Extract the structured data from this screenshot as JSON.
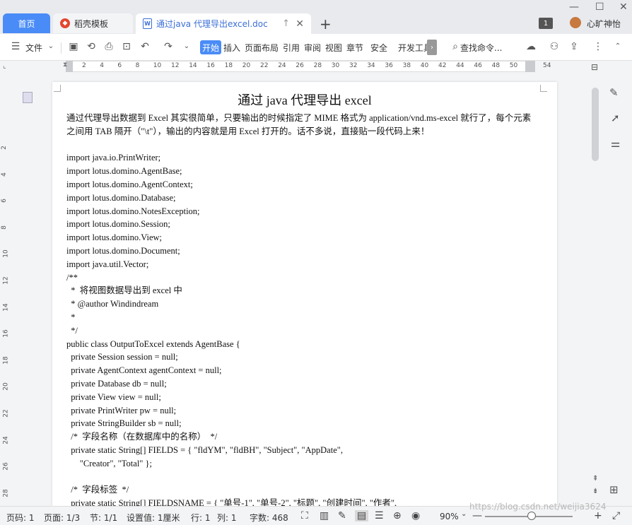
{
  "tabs": {
    "home": "首页",
    "template": "稻壳模板",
    "doc": "通过java 代理导出excel.doc"
  },
  "user": {
    "name": "心旷神怡",
    "notify_count": "1"
  },
  "toolbar": {
    "file": "文件",
    "start": "开始",
    "insert": "插入",
    "layout": "页面布局",
    "reference": "引用",
    "review": "审阅",
    "view": "视图",
    "chapter": "章节",
    "security": "安全",
    "dev": "开发工具",
    "search": "查找命令..."
  },
  "ruler": {
    "top": [
      "2",
      "4",
      "6",
      "8",
      "10",
      "12",
      "14",
      "16",
      "18",
      "20",
      "22",
      "24",
      "26",
      "28",
      "30",
      "32",
      "34",
      "36",
      "38",
      "40",
      "42",
      "44",
      "46",
      "48",
      "50",
      "54"
    ],
    "left": [
      "2",
      "4",
      "6",
      "8",
      "10",
      "12",
      "14",
      "16",
      "18",
      "20",
      "22",
      "24",
      "26",
      "28",
      "30"
    ]
  },
  "document": {
    "title": "通过 java  代理导出 excel",
    "intro_1": "通过代理导出数据到 Excel 其实很简单，只要输出的时候指定了 MIME 格式为 application/vnd.ms-excel 就行了，每个元素",
    "intro_2": "之间用 TAB 隔开（\"\\t\"），输出的内容就是用 Excel 打开的。话不多说，直接贴一段代码上来！",
    "code": [
      "import java.io.PrintWriter;",
      "import lotus.domino.AgentBase;",
      "import lotus.domino.AgentContext;",
      "import lotus.domino.Database;",
      "import lotus.domino.NotesException;",
      "import lotus.domino.Session;",
      "import lotus.domino.View;",
      "import lotus.domino.Document;",
      "import java.util.Vector;",
      "/**",
      "  *  将视图数据导出到 excel 中",
      "  * @author Windindream",
      "  *",
      "  */",
      "public class OutputToExcel extends AgentBase {",
      "  private Session session = null;",
      "  private AgentContext agentContext = null;",
      "  private Database db = null;",
      "  private View view = null;",
      "  private PrintWriter pw = null;",
      "  private StringBuilder sb = null;",
      "  /*  字段名称（在数据库中的名称）  */",
      "  private static String[] FIELDS = { \"fldYM\", \"fldBH\", \"Subject\", \"AppDate\",",
      "      \"Creator\", \"Total\" };",
      "",
      "  /*  字段标签  */",
      "  private static String[] FIELDSNAME = { \"单号-1\", \"单号-2\", \"标题\", \"创建时间\", \"作者\","
    ]
  },
  "status": {
    "page_num": "页码: 1",
    "page_of": "页面: 1/3",
    "section": "节: 1/1",
    "setting": "设置值: 1厘米",
    "row": "行: 1",
    "col": "列: 1",
    "words": "字数: 468",
    "zoom": "90%"
  },
  "watermark": "https://blog.csdn.net/weijia3624"
}
